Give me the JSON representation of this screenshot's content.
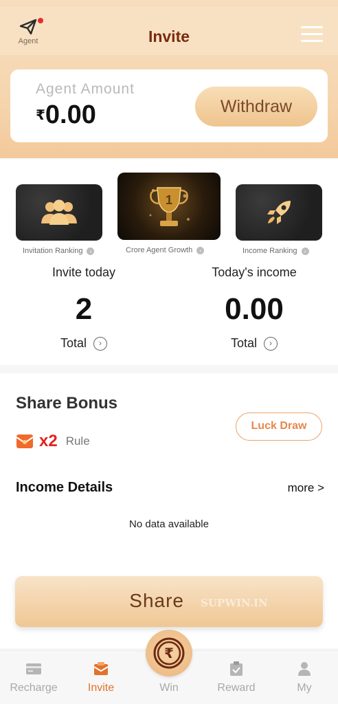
{
  "header": {
    "agent_label": "Agent",
    "title": "Invite",
    "icons": {
      "agent": "paper-plane-icon",
      "menu": "hamburger-menu-icon"
    }
  },
  "amount_card": {
    "label": "Agent Amount",
    "currency": "₹",
    "value": "0.00",
    "withdraw_label": "Withdraw"
  },
  "rankings": [
    {
      "caption": "Invitation Ranking",
      "icon": "people-icon"
    },
    {
      "caption": "Crore Agent Growth",
      "icon": "trophy-icon"
    },
    {
      "caption": "Income Ranking",
      "icon": "rocket-icon"
    }
  ],
  "stats": {
    "invite_today_label": "Invite today",
    "invite_today_value": "2",
    "todays_income_label": "Today's income",
    "todays_income_value": "0.00",
    "total_label": "Total"
  },
  "bonus": {
    "title": "Share Bonus",
    "multiplier": "x2",
    "rule_label": "Rule",
    "luck_draw_label": "Luck Draw"
  },
  "income_details": {
    "title": "Income Details",
    "more_label": "more >",
    "empty_text": "No data available"
  },
  "share": {
    "label": "Share",
    "watermark": "SUPWIN.IN"
  },
  "tabbar": {
    "tabs": [
      {
        "label": "Recharge",
        "icon": "wallet-icon",
        "active": false
      },
      {
        "label": "Invite",
        "icon": "envelope-icon",
        "active": true
      },
      {
        "label": "Win",
        "icon": "rupee-coin-icon",
        "active": false
      },
      {
        "label": "Reward",
        "icon": "clipboard-icon",
        "active": false
      },
      {
        "label": "My",
        "icon": "person-icon",
        "active": false
      }
    ]
  },
  "colors": {
    "accent": "#e2722c",
    "title": "#7a2a10",
    "header_bg": "#f6d6b0",
    "danger": "#e2221f"
  }
}
